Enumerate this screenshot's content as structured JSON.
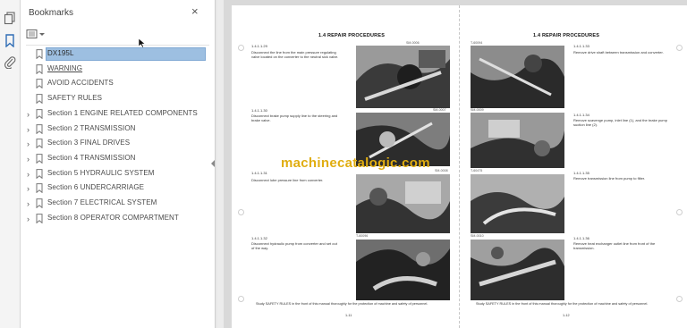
{
  "panel": {
    "title": "Bookmarks",
    "close_glyph": "×",
    "items": [
      {
        "label": "DX195L",
        "expandable": false,
        "selected": true,
        "underlined": false
      },
      {
        "label": "WARNING",
        "expandable": false,
        "selected": false,
        "underlined": true
      },
      {
        "label": "AVOID ACCIDENTS",
        "expandable": false,
        "selected": false,
        "underlined": false
      },
      {
        "label": "SAFETY RULES",
        "expandable": false,
        "selected": false,
        "underlined": false
      },
      {
        "label": "Section 1 ENGINE RELATED COMPONENTS",
        "expandable": true,
        "selected": false,
        "underlined": false
      },
      {
        "label": "Section 2 TRANSMISSION",
        "expandable": true,
        "selected": false,
        "underlined": false
      },
      {
        "label": "Section 3 FINAL DRIVES",
        "expandable": true,
        "selected": false,
        "underlined": false
      },
      {
        "label": "Section 4 TRANSMISSION",
        "expandable": true,
        "selected": false,
        "underlined": false
      },
      {
        "label": "Section 5 HYDRAULIC SYSTEM",
        "expandable": true,
        "selected": false,
        "underlined": false
      },
      {
        "label": "Section 6 UNDERCARRIAGE",
        "expandable": true,
        "selected": false,
        "underlined": false
      },
      {
        "label": "Section 7 ELECTRICAL SYSTEM",
        "expandable": true,
        "selected": false,
        "underlined": false
      },
      {
        "label": "Section 8 OPERATOR COMPARTMENT",
        "expandable": true,
        "selected": false,
        "underlined": false
      }
    ]
  },
  "toolbar": {
    "icons": [
      "pages-icon",
      "bookmark-icon",
      "attachment-icon"
    ]
  },
  "page_left": {
    "title": "1.4  REPAIR PROCEDURES",
    "steps": [
      {
        "num": "1.4.1.1.29",
        "text": "Disconnect the line from the main pressure regulating valve located on the converter to the neutral sick valve.",
        "photo_code": "SM-0006"
      },
      {
        "num": "1.4.1.1.30",
        "text": "Disconnect brake pump supply line to the steering and brake valve.",
        "photo_code": "SM-0007"
      },
      {
        "num": "1.4.1.1.31",
        "text": "Disconnect lube pressure line from converter.",
        "photo_code": "SM-0008"
      },
      {
        "num": "1.4.1.1.32",
        "text": "Disconnect hydraulic pump from converter and set out of the way.",
        "photo_code": "T-60096"
      }
    ],
    "footer": "Study SAFETY RULES in the front of this manual thoroughly for the protection of machine and safety of personnel.",
    "page_number": "1-11"
  },
  "page_right": {
    "title": "1.4  REPAIR PROCEDURES",
    "steps": [
      {
        "num": "1.4.1.1.33",
        "text": "Remove drive shaft between transmission and converter.",
        "photo_code": "T-60094"
      },
      {
        "num": "1.4.1.1.34",
        "text": "Remove scavenge pump, inlet line (1), and the brake pump suction line (2).",
        "photo_code": "SM-0009"
      },
      {
        "num": "1.4.1.1.35",
        "text": "Remove transmission line from pump to filter.",
        "photo_code": "T-60475"
      },
      {
        "num": "1.4.1.1.36",
        "text": "Remove heat exchanger outlet line from front of the transmission.",
        "photo_code": "SM-0010"
      }
    ],
    "footer": "Study SAFETY RULES in the front of this manual thoroughly for the protection of machine and safety of personnel.",
    "page_number": "1-12"
  },
  "watermark": "machinecatalogic.com",
  "colors": {
    "selection": "#9dbfe1",
    "accent_icon": "#2f6db5",
    "watermark": "#e0ad10"
  }
}
